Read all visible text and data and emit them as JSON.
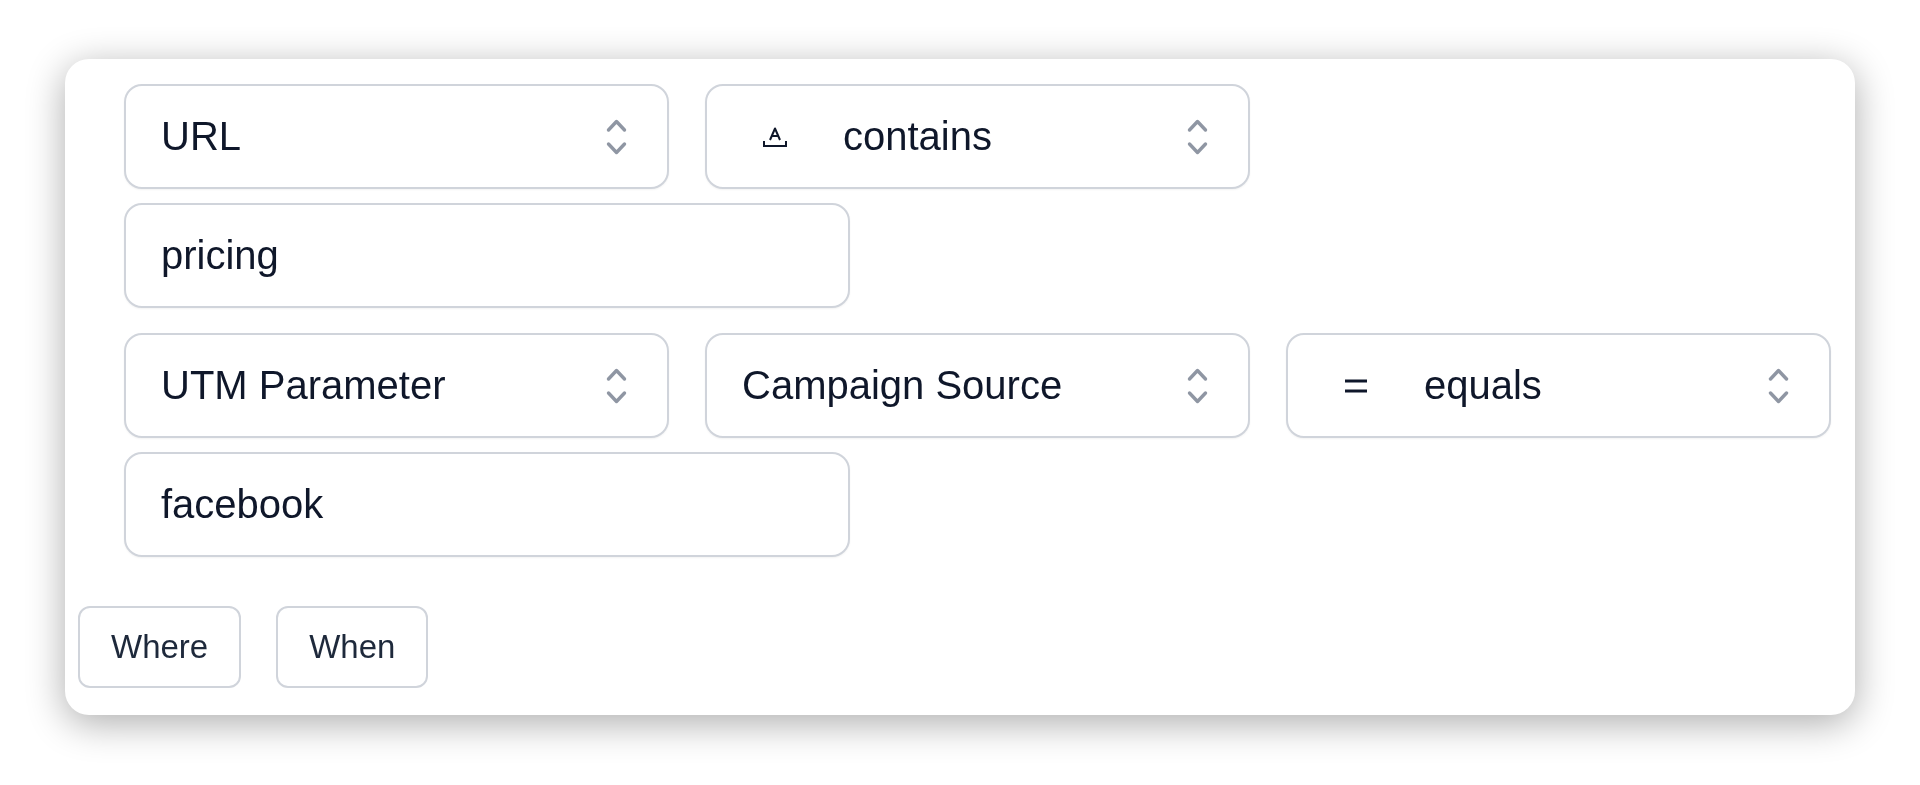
{
  "filters": [
    {
      "selects": [
        {
          "kind": "plain",
          "value": "URL"
        },
        {
          "kind": "match",
          "value": "contains"
        }
      ],
      "input": {
        "value": "pricing"
      }
    },
    {
      "selects": [
        {
          "kind": "plain",
          "value": "UTM Parameter"
        },
        {
          "kind": "plain",
          "value": "Campaign Source"
        },
        {
          "kind": "equality",
          "value": "equals"
        }
      ],
      "input": {
        "value": "facebook"
      }
    }
  ],
  "buttons": [
    {
      "label": "Where"
    },
    {
      "label": "When"
    }
  ]
}
